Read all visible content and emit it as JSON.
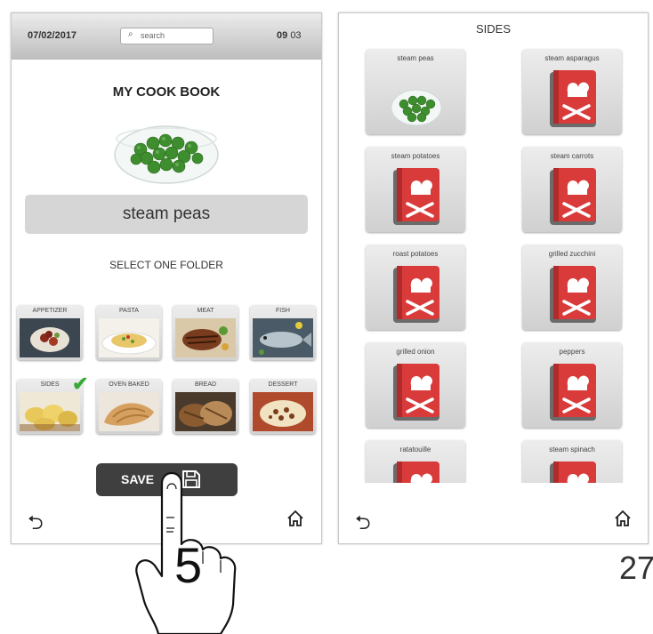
{
  "left_screen": {
    "status_bar": {
      "date": "07/02/2017",
      "search_placeholder": "search",
      "time_hour": "09",
      "time_minute": "03"
    },
    "title": "MY COOK BOOK",
    "recipe_name": "steam peas",
    "select_label": "SELECT ONE FOLDER",
    "folders": [
      {
        "label": "APPETIZER"
      },
      {
        "label": "PASTA"
      },
      {
        "label": "MEAT"
      },
      {
        "label": "FISH"
      },
      {
        "label": "SIDES"
      },
      {
        "label": "OVEN BAKED"
      },
      {
        "label": "BREAD"
      },
      {
        "label": "DESSERT"
      }
    ],
    "selected_folder": "SIDES",
    "save_label": "SAVE"
  },
  "right_screen": {
    "title": "SIDES",
    "recipes": [
      {
        "label": "steam peas",
        "thumb": "peas-photo"
      },
      {
        "label": "steam asparagus",
        "thumb": "cookbook-icon"
      },
      {
        "label": "steam potatoes",
        "thumb": "cookbook-icon"
      },
      {
        "label": "steam carrots",
        "thumb": "cookbook-icon"
      },
      {
        "label": "roast potatoes",
        "thumb": "cookbook-icon"
      },
      {
        "label": "grilled zucchini",
        "thumb": "cookbook-icon"
      },
      {
        "label": "grilled onion",
        "thumb": "cookbook-icon"
      },
      {
        "label": "peppers",
        "thumb": "cookbook-icon"
      },
      {
        "label": "ratatouille",
        "thumb": "cookbook-icon"
      },
      {
        "label": "steam spinach",
        "thumb": "cookbook-icon"
      }
    ]
  },
  "step_number": "5",
  "page_number": "27",
  "icons": {
    "back": "back-arrow-icon",
    "home": "home-icon",
    "save": "floppy-disk-icon",
    "check": "checkmark-icon"
  },
  "colors": {
    "accent_red": "#d93a3a",
    "check_green": "#3aa83a",
    "save_button": "#3f3f3f"
  }
}
